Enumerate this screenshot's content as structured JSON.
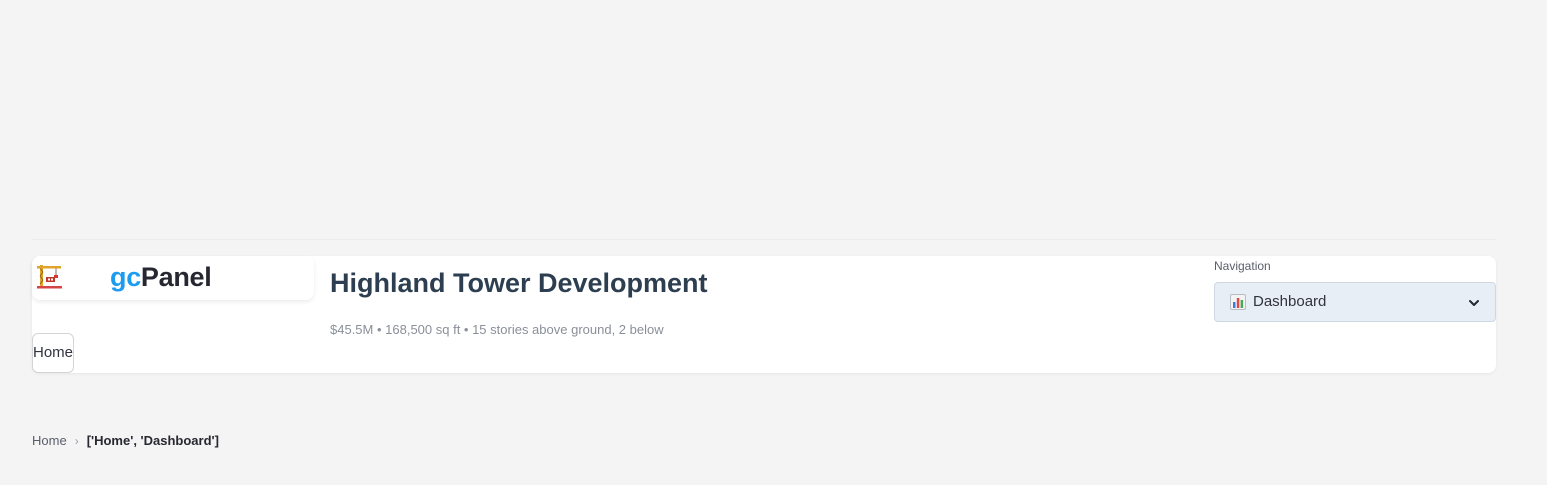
{
  "brand": {
    "prefix": "gc",
    "name": "Panel",
    "logo_icon": "construction-crane-icon"
  },
  "home_button": {
    "label": "Home"
  },
  "project": {
    "title": "Highland Tower Development",
    "subtitle": "$45.5M • 168,500 sq ft • 15 stories above ground, 2 below"
  },
  "navigation": {
    "label": "Navigation",
    "selected": "Dashboard",
    "selected_icon": "bar-chart-icon"
  },
  "breadcrumb": {
    "root": "Home",
    "separator": "›",
    "current": "['Home', 'Dashboard']"
  },
  "colors": {
    "background": "#f4f4f4",
    "brand_accent": "#1c9cf0",
    "title": "#2d3e50",
    "select_bg": "#e8eef5"
  }
}
